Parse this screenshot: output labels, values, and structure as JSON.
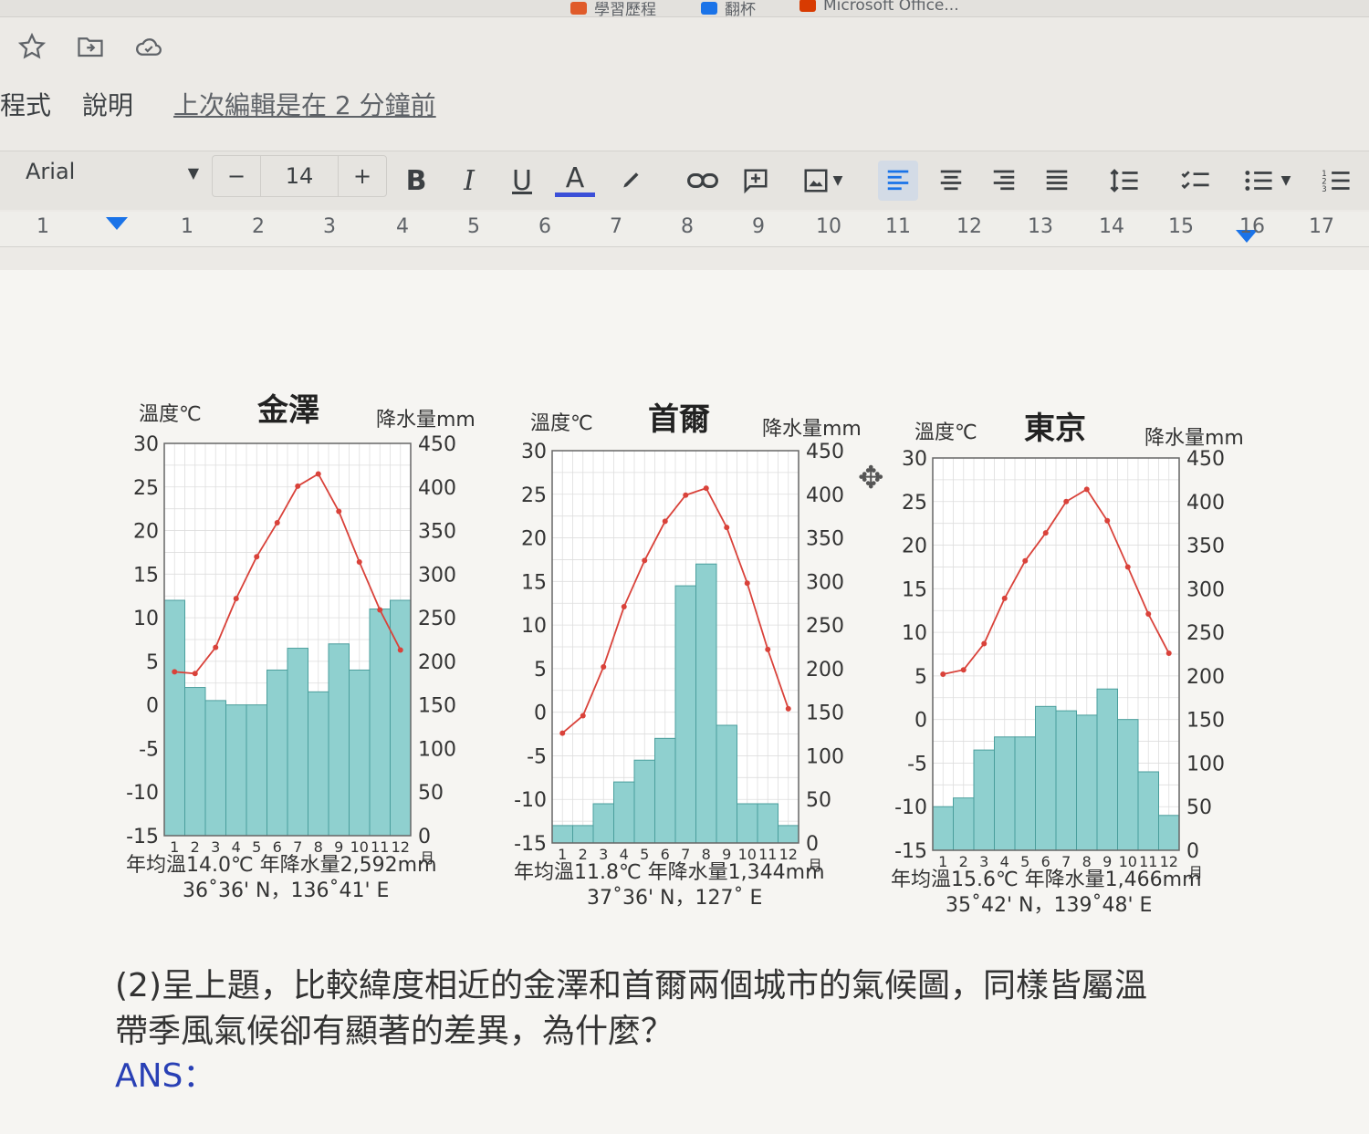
{
  "bookmarks": [
    {
      "label": "學習歷程",
      "color": "#e05b2a"
    },
    {
      "label": "翻杯",
      "color": "#1a73e8"
    },
    {
      "label": "Microsoft Office...",
      "color": "#d83b01"
    }
  ],
  "doc_icons": [
    "star-icon",
    "move-to-folder-icon",
    "cloud-saved-icon"
  ],
  "menu": {
    "items": [
      "程式",
      "說明"
    ],
    "last_edit": "上次編輯是在 2 分鐘前"
  },
  "toolbar": {
    "font": "Arial",
    "font_size": "14",
    "minus": "−",
    "plus": "+",
    "bold": "B",
    "italic": "I",
    "underline": "U",
    "text_color": "A",
    "text_color_value": "#3b4fd8",
    "icons": [
      "highlight-icon",
      "link-icon",
      "insert-comment-icon",
      "insert-image-icon",
      "align-left-icon",
      "align-center-icon",
      "align-right-icon",
      "justify-icon",
      "line-spacing-icon",
      "checklist-icon",
      "bulleted-list-icon",
      "numbered-list-icon"
    ]
  },
  "ruler": {
    "numbers": [
      "1",
      "1",
      "2",
      "3",
      "4",
      "5",
      "6",
      "7",
      "8",
      "9",
      "10",
      "11",
      "12",
      "13",
      "14",
      "15",
      "16",
      "17"
    ]
  },
  "chart_data": [
    {
      "type": "bar",
      "title": "金澤",
      "ylabel_left": "溫度℃",
      "ylabel_right": "降水量mm",
      "x_unit": "月",
      "categories": [
        "1",
        "2",
        "3",
        "4",
        "5",
        "6",
        "7",
        "8",
        "9",
        "10",
        "11",
        "12"
      ],
      "temp_ylim": [
        -15,
        30
      ],
      "temp_ticks": [
        "30",
        "25",
        "20",
        "15",
        "10",
        "5",
        "0",
        "-5",
        "-10",
        "-15"
      ],
      "precip_ylim": [
        0,
        450
      ],
      "precip_ticks": [
        "450",
        "400",
        "350",
        "300",
        "250",
        "200",
        "150",
        "100",
        "50",
        "0"
      ],
      "series": [
        {
          "kind": "temperature",
          "values": [
            3.8,
            3.6,
            6.6,
            12.2,
            17,
            20.9,
            25.1,
            26.5,
            22.2,
            16.4,
            10.9,
            6.3
          ],
          "color": "#d9423a"
        },
        {
          "kind": "precipitation",
          "values": [
            270,
            170,
            155,
            150,
            150,
            190,
            215,
            165,
            220,
            190,
            260,
            270
          ],
          "color": "#8fd0cf"
        }
      ],
      "stats": "年均溫14.0℃ 年降水量2,592mm",
      "coords": "36˚36' N，136˚41' E"
    },
    {
      "type": "bar",
      "title": "首爾",
      "ylabel_left": "溫度℃",
      "ylabel_right": "降水量mm",
      "x_unit": "月",
      "categories": [
        "1",
        "2",
        "3",
        "4",
        "5",
        "6",
        "7",
        "8",
        "9",
        "10",
        "11",
        "12"
      ],
      "temp_ylim": [
        -15,
        30
      ],
      "temp_ticks": [
        "30",
        "25",
        "20",
        "15",
        "10",
        "5",
        "0",
        "-5",
        "-10",
        "-15"
      ],
      "precip_ylim": [
        0,
        450
      ],
      "precip_ticks": [
        "450",
        "400",
        "350",
        "300",
        "250",
        "200",
        "150",
        "100",
        "50",
        "0"
      ],
      "series": [
        {
          "kind": "temperature",
          "values": [
            -2.4,
            -0.4,
            5.2,
            12.1,
            17.4,
            21.9,
            24.9,
            25.7,
            21.2,
            14.8,
            7.2,
            0.4
          ],
          "color": "#d9423a"
        },
        {
          "kind": "precipitation",
          "values": [
            20,
            20,
            45,
            70,
            95,
            120,
            295,
            320,
            135,
            45,
            45,
            20
          ],
          "color": "#8fd0cf"
        }
      ],
      "stats": "年均溫11.8℃ 年降水量1,344mm",
      "coords": "37˚36' N，127˚ E"
    },
    {
      "type": "bar",
      "title": "東京",
      "ylabel_left": "溫度℃",
      "ylabel_right": "降水量mm",
      "x_unit": "月",
      "categories": [
        "1",
        "2",
        "3",
        "4",
        "5",
        "6",
        "7",
        "8",
        "9",
        "10",
        "11",
        "12"
      ],
      "temp_ylim": [
        -15,
        30
      ],
      "temp_ticks": [
        "30",
        "25",
        "20",
        "15",
        "10",
        "5",
        "0",
        "-5",
        "-10",
        "-15"
      ],
      "precip_ylim": [
        0,
        450
      ],
      "precip_ticks": [
        "450",
        "400",
        "350",
        "300",
        "250",
        "200",
        "150",
        "100",
        "50",
        "0"
      ],
      "series": [
        {
          "kind": "temperature",
          "values": [
            5.2,
            5.7,
            8.7,
            13.9,
            18.2,
            21.4,
            25,
            26.4,
            22.8,
            17.5,
            12.1,
            7.6
          ],
          "color": "#d9423a"
        },
        {
          "kind": "precipitation",
          "values": [
            50,
            60,
            115,
            130,
            130,
            165,
            160,
            155,
            185,
            150,
            90,
            40
          ],
          "color": "#8fd0cf"
        }
      ],
      "stats": "年均溫15.6℃ 年降水量1,466mm",
      "coords": "35˚42' N，139˚48' E"
    }
  ],
  "question": {
    "line1": "(2)呈上題，比較緯度相近的金澤和首爾兩個城市的氣候圖，同樣皆屬溫",
    "line2": "帶季風氣候卻有顯著的差異，為什麼？",
    "ans_label": "ANS："
  }
}
